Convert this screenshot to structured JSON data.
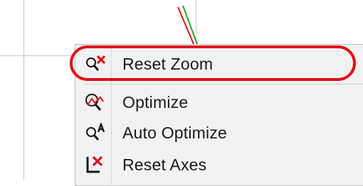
{
  "menu": {
    "items": [
      {
        "label": "Reset Zoom",
        "icon": "reset-zoom-icon"
      },
      {
        "label": "Optimize",
        "icon": "optimize-icon"
      },
      {
        "label": "Auto Optimize",
        "icon": "auto-optimize-icon"
      },
      {
        "label": "Reset Axes",
        "icon": "reset-axes-icon"
      }
    ]
  },
  "colors": {
    "highlight": "#e0101a",
    "menu_bg": "#f2f2f2",
    "plot_line_red": "#e0101a",
    "plot_line_green": "#2aa52a",
    "icon_dark": "#1a1a1a"
  }
}
